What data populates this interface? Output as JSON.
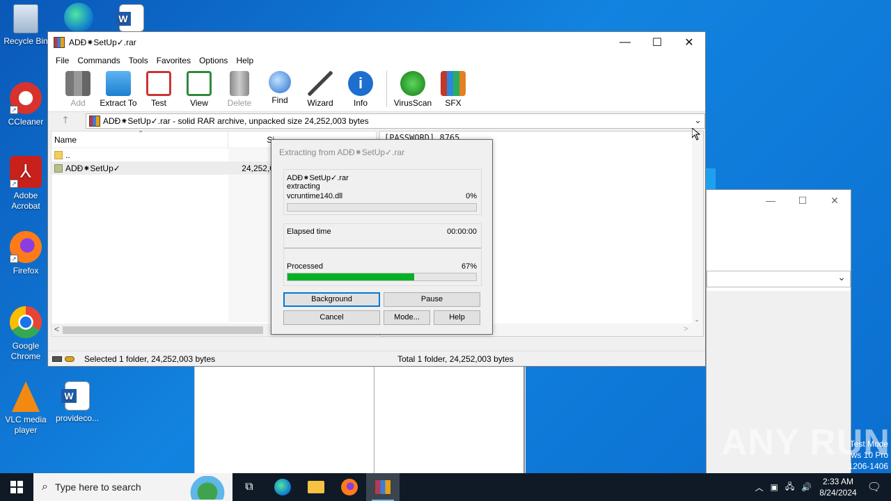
{
  "desktop": {
    "icons": [
      {
        "label": "Recycle Bin",
        "icon": "recycle-bin-icon"
      },
      {
        "label": "CCleaner",
        "icon": "ccleaner-icon"
      },
      {
        "label": "Adobe Acrobat",
        "icon": "adobe-acrobat-icon"
      },
      {
        "label": "Firefox",
        "icon": "firefox-icon"
      },
      {
        "label": "Google Chrome",
        "icon": "chrome-icon"
      },
      {
        "label": "VLC media player",
        "icon": "vlc-icon"
      },
      {
        "label": "provideco...",
        "icon": "word-doc-icon"
      }
    ],
    "watermark": "ANY RUN",
    "test_mode": {
      "line1": "Test Mode",
      "line2": "ws 10 Pro",
      "line3": "1206-1406"
    }
  },
  "winrar": {
    "title": "ADÐ⁕SetUp✓.rar",
    "menu": [
      "File",
      "Commands",
      "Tools",
      "Favorites",
      "Options",
      "Help"
    ],
    "toolbar": [
      {
        "label": "Add",
        "icon": "add-archive-icon",
        "disabled": true
      },
      {
        "label": "Extract To",
        "icon": "extract-folder-icon",
        "disabled": false
      },
      {
        "label": "Test",
        "icon": "test-clipboard-icon",
        "disabled": false
      },
      {
        "label": "View",
        "icon": "view-book-icon",
        "disabled": false
      },
      {
        "label": "Delete",
        "icon": "trash-icon",
        "disabled": true
      },
      {
        "label": "Find",
        "icon": "magnifier-icon",
        "disabled": false
      },
      {
        "label": "Wizard",
        "icon": "magic-wand-icon",
        "disabled": false
      },
      {
        "label": "Info",
        "icon": "info-icon",
        "disabled": false
      },
      {
        "label": "VirusScan",
        "icon": "virus-scan-icon",
        "disabled": false
      },
      {
        "label": "SFX",
        "icon": "sfx-books-icon",
        "disabled": false
      }
    ],
    "address": "ADÐ⁕SetUp✓.rar - solid RAR archive, unpacked size 24,252,003 bytes",
    "columns": {
      "name": "Name",
      "size": "Si"
    },
    "files": [
      {
        "name": "..",
        "size": ""
      },
      {
        "name": "ADÐ⁕SetUp✓",
        "size": "24,252,0"
      }
    ],
    "comment": "[PASSWORD]  8765",
    "status_left": "Selected 1 folder, 24,252,003 bytes",
    "status_right": "Total 1 folder, 24,252,003 bytes"
  },
  "dialog": {
    "title": "Extracting from ADÐ⁕SetUp✓.rar",
    "archive": "ADÐ⁕SetUp✓.rar",
    "action": "extracting",
    "file": "vcruntime140.dll",
    "file_percent": "0%",
    "file_progress": 0,
    "elapsed_label": "Elapsed time",
    "elapsed_value": "00:00:00",
    "processed_label": "Processed",
    "processed_percent": "67%",
    "processed_progress": 0.67,
    "buttons": {
      "background": "Background",
      "pause": "Pause",
      "cancel": "Cancel",
      "mode": "Mode...",
      "help": "Help"
    }
  },
  "taskbar": {
    "search_placeholder": "Type here to search",
    "time": "2:33 AM",
    "date": "8/24/2024"
  },
  "colors": {
    "accent": "#0078d7",
    "progress": "#06b025",
    "taskbar": "#101a26",
    "desktop": "#0a78d4"
  }
}
